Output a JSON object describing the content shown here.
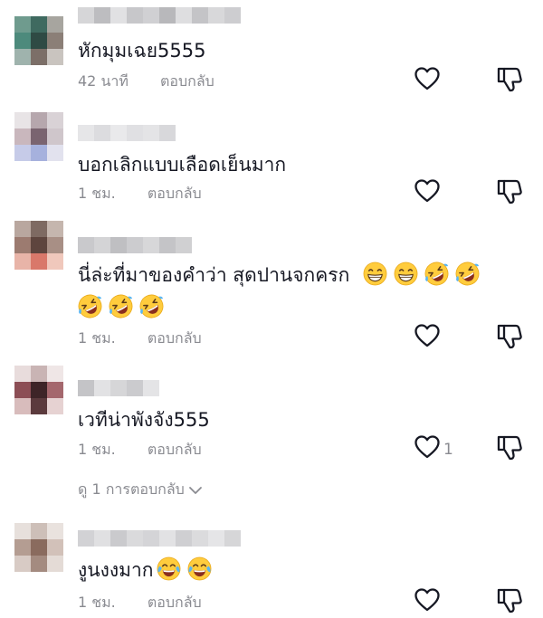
{
  "comments": [
    {
      "text": "หักมุมเฉย5555",
      "emojis": [],
      "time": "42 นาที",
      "reply_label": "ตอบกลับ",
      "like_count": "",
      "avatar_colors": [
        "#6f9b8e",
        "#3f6a60",
        "#a7a59f",
        "#4d8a7c",
        "#2f4a44",
        "#8b7f77",
        "#9fb3ad",
        "#7c6f68",
        "#c9c4bf"
      ],
      "name_colors": [
        "#d6d6d8",
        "#bdbdc0",
        "#e1e1e3",
        "#c7c7ca",
        "#d0d0d3",
        "#b8b8bb",
        "#dedee0",
        "#c4c4c7",
        "#d8d8da",
        "#cdcdd0"
      ]
    },
    {
      "text": "บอกเลิกแบบเลือดเย็นมาก",
      "emojis": [],
      "time": "1 ชม.",
      "reply_label": "ตอบกลับ",
      "like_count": "",
      "avatar_colors": [
        "#e8e4e6",
        "#b6a7ad",
        "#d9d2d6",
        "#c9b7bd",
        "#7a6470",
        "#cfc6cb",
        "#c6cbe8",
        "#a6b1dd",
        "#e2e2ee"
      ],
      "name_colors": [
        "#e6e6e8",
        "#dcdcdf",
        "#e9e9eb",
        "#e0e0e3",
        "#e4e4e6",
        "#d8d8db"
      ]
    },
    {
      "text": "นี่ล่ะที่มาของคำว่า สุดปานจกครก",
      "emojis": [
        "grin",
        "grin",
        "rofl",
        "rofl"
      ],
      "emojis_line2": [
        "rofl",
        "rofl",
        "rofl"
      ],
      "time": "1 ชม.",
      "reply_label": "ตอบกลับ",
      "like_count": "",
      "avatar_colors": [
        "#b9a79f",
        "#7e6a62",
        "#c5b6ae",
        "#9c7b70",
        "#5e453e",
        "#a88f85",
        "#e8b4a8",
        "#d9786a",
        "#f0c8bc"
      ],
      "name_colors": [
        "#c9c9cc",
        "#d4d4d6",
        "#bfbfc2",
        "#cccccf",
        "#d7d7d9",
        "#c4c4c7",
        "#d0d0d2"
      ]
    },
    {
      "text": "เวทีน่าพังจัง555",
      "emojis": [],
      "time": "1 ชม.",
      "reply_label": "ตอบกลับ",
      "like_count": "1",
      "view_replies": "ดู 1 การตอบกลับ",
      "avatar_colors": [
        "#e8dcdc",
        "#c9b4b4",
        "#efe6e6",
        "#8c4e55",
        "#3d2427",
        "#a4676d",
        "#d8bcbc",
        "#5b3a3d",
        "#e6d2d2"
      ],
      "name_colors": [
        "#c4c4c7",
        "#e2e2e4",
        "#d6d6d8",
        "#cbcbce",
        "#e4e4e6"
      ]
    },
    {
      "text": "งูนงงมาก",
      "emojis": [
        "tears",
        "tears"
      ],
      "time": "1 ชม.",
      "reply_label": "ตอบกลับ",
      "like_count": "",
      "avatar_colors": [
        "#e7e0dc",
        "#cdbfb8",
        "#e9e2de",
        "#b49d92",
        "#8a6b5e",
        "#d2c1b9",
        "#d8cbc5",
        "#a48b80",
        "#e4dbd6"
      ],
      "name_colors": [
        "#d2d2d5",
        "#e0e0e2",
        "#cacacd",
        "#dadadc",
        "#d4d4d7",
        "#e2e2e4",
        "#cfcfd2",
        "#dbdbdd",
        "#e5e5e7",
        "#d6d6d8"
      ]
    }
  ],
  "icons": {
    "like": "heart-outline-icon",
    "dislike": "thumbs-down-outline-icon",
    "expand": "chevron-down-icon"
  },
  "colors": {
    "text": "#161823",
    "meta": "#8a8b91",
    "icon": "#161823"
  }
}
